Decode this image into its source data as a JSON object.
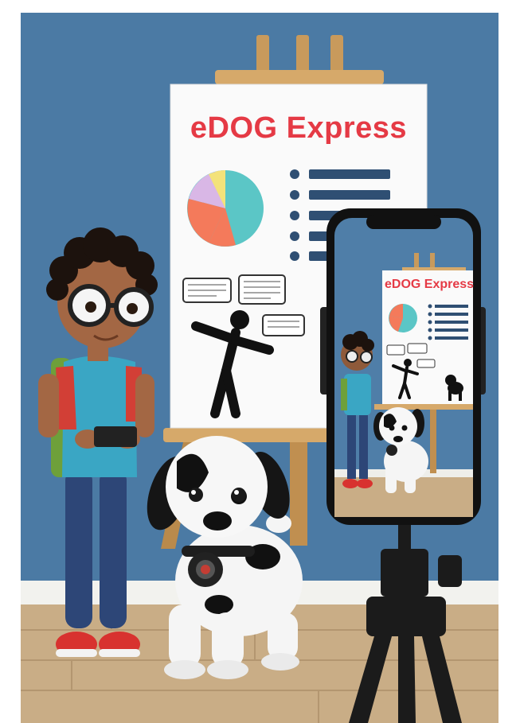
{
  "poster": {
    "title": "eDOG Express"
  },
  "phone_screen": {
    "title": "eDOG Express"
  },
  "colors": {
    "wall": "#4f7ea8",
    "floor": "#c9ad86",
    "poster_title": "#e53a45",
    "pie_teal": "#5bc6c6",
    "pie_orange": "#f47a5b",
    "pie_lavender": "#d9b7e6",
    "pie_yellow": "#f3e27a",
    "bullet_navy": "#2f4f73"
  },
  "icons": {
    "chart": "pie-chart-icon",
    "list": "bullet-list-icon",
    "speaker": "stick-figure-speaker-icon",
    "camera": "smartphone-on-tripod-icon",
    "pet": "spotted-dog-icon"
  }
}
